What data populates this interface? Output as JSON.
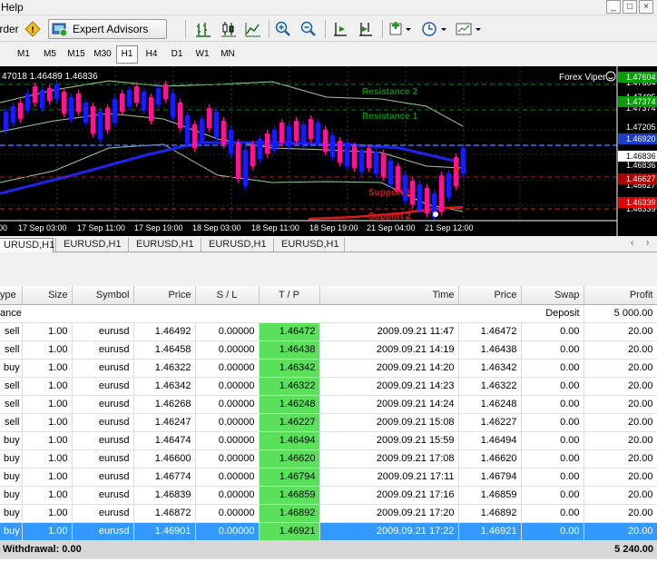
{
  "menu": {
    "help": "Help"
  },
  "window_buttons": [
    "_",
    "□",
    "×"
  ],
  "toolbar": {
    "order_label": "rder",
    "expert_advisors": "Expert Advisors"
  },
  "timeframes": [
    "M1",
    "M5",
    "M15",
    "M30",
    "H1",
    "H4",
    "D1",
    "W1",
    "MN"
  ],
  "active_timeframe": "H1",
  "chart": {
    "ohlc_header": "47018 1.46489 1.46836",
    "indicator_name": "Forex Viper",
    "labels": {
      "resistance2": "Resistance 2",
      "resistance1": "Resistance 1",
      "support1": "Support 1",
      "support2": "Support 2"
    },
    "price_labels": [
      "1.47604",
      "1.47485",
      "1.47374",
      "1.47205",
      "1.46920",
      "1.46836",
      "1.46627",
      "1.46339",
      "1.46070"
    ],
    "price_tags": [
      {
        "text": "1.47604",
        "color": "#00a000"
      },
      {
        "text": "1.47374",
        "color": "#00a000"
      },
      {
        "text": "1.46920",
        "color": "#1c3ccc"
      },
      {
        "text": "1.46836",
        "color": "#ffffff"
      },
      {
        "text": "1.46627",
        "color": "#b00000"
      },
      {
        "text": "1.46339",
        "color": "#e00000"
      }
    ],
    "time_labels": [
      "00",
      "17 Sep 03:00",
      "17 Sep 11:00",
      "17 Sep 19:00",
      "18 Sep 03:00",
      "18 Sep 11:00",
      "18 Sep 19:00",
      "21 Sep 04:00",
      "21 Sep 12:00"
    ],
    "colors": {
      "bull": "#1a1aff",
      "bear": "#ff1493",
      "ma": "#2222ee",
      "support": "#e01818",
      "resistance": "#0c8a0c",
      "bands": "#9acd9a"
    }
  },
  "chart_tabs": [
    "URUSD,H1",
    "EURUSD,H1",
    "EURUSD,H1",
    "EURUSD,H1",
    "EURUSD,H1"
  ],
  "chart_tab_nav": [
    "‹",
    "›"
  ],
  "table": {
    "headers": [
      "ype",
      "Size",
      "Symbol",
      "Price",
      "S / L",
      "T / P",
      "Time",
      "Price",
      "Swap",
      "Profit"
    ],
    "balance_row": {
      "type": "ance",
      "label": "Deposit",
      "amount": "5 000.00"
    },
    "rows": [
      [
        "sell",
        "1.00",
        "eurusd",
        "1.46492",
        "0.00000",
        "1.46472",
        "2009.09.21 11:47",
        "1.46472",
        "0.00",
        "20.00"
      ],
      [
        "sell",
        "1.00",
        "eurusd",
        "1.46458",
        "0.00000",
        "1.46438",
        "2009.09.21 14:19",
        "1.46438",
        "0.00",
        "20.00"
      ],
      [
        "buy",
        "1.00",
        "eurusd",
        "1.46322",
        "0.00000",
        "1.46342",
        "2009.09.21 14:20",
        "1.46342",
        "0.00",
        "20.00"
      ],
      [
        "sell",
        "1.00",
        "eurusd",
        "1.46342",
        "0.00000",
        "1.46322",
        "2009.09.21 14:23",
        "1.46322",
        "0.00",
        "20.00"
      ],
      [
        "sell",
        "1.00",
        "eurusd",
        "1.46268",
        "0.00000",
        "1.46248",
        "2009.09.21 14:24",
        "1.46248",
        "0.00",
        "20.00"
      ],
      [
        "sell",
        "1.00",
        "eurusd",
        "1.46247",
        "0.00000",
        "1.46227",
        "2009.09.21 15:08",
        "1.46227",
        "0.00",
        "20.00"
      ],
      [
        "buy",
        "1.00",
        "eurusd",
        "1.46474",
        "0.00000",
        "1.46494",
        "2009.09.21 15:59",
        "1.46494",
        "0.00",
        "20.00"
      ],
      [
        "buy",
        "1.00",
        "eurusd",
        "1.46600",
        "0.00000",
        "1.46620",
        "2009.09.21 17:08",
        "1.46620",
        "0.00",
        "20.00"
      ],
      [
        "buy",
        "1.00",
        "eurusd",
        "1.46774",
        "0.00000",
        "1.46794",
        "2009.09.21 17:11",
        "1.46794",
        "0.00",
        "20.00"
      ],
      [
        "buy",
        "1.00",
        "eurusd",
        "1.46839",
        "0.00000",
        "1.46859",
        "2009.09.21 17:16",
        "1.46859",
        "0.00",
        "20.00"
      ],
      [
        "buy",
        "1.00",
        "eurusd",
        "1.46872",
        "0.00000",
        "1.46892",
        "2009.09.21 17:20",
        "1.46892",
        "0.00",
        "20.00"
      ],
      [
        "buy",
        "1.00",
        "eurusd",
        "1.46901",
        "0.00000",
        "1.46921",
        "2009.09.21 17:22",
        "1.46921",
        "0.00",
        "20.00"
      ]
    ],
    "selected_row": 11,
    "summary": {
      "label": "Withdrawal: 0.00",
      "total": "5 240.00"
    }
  }
}
